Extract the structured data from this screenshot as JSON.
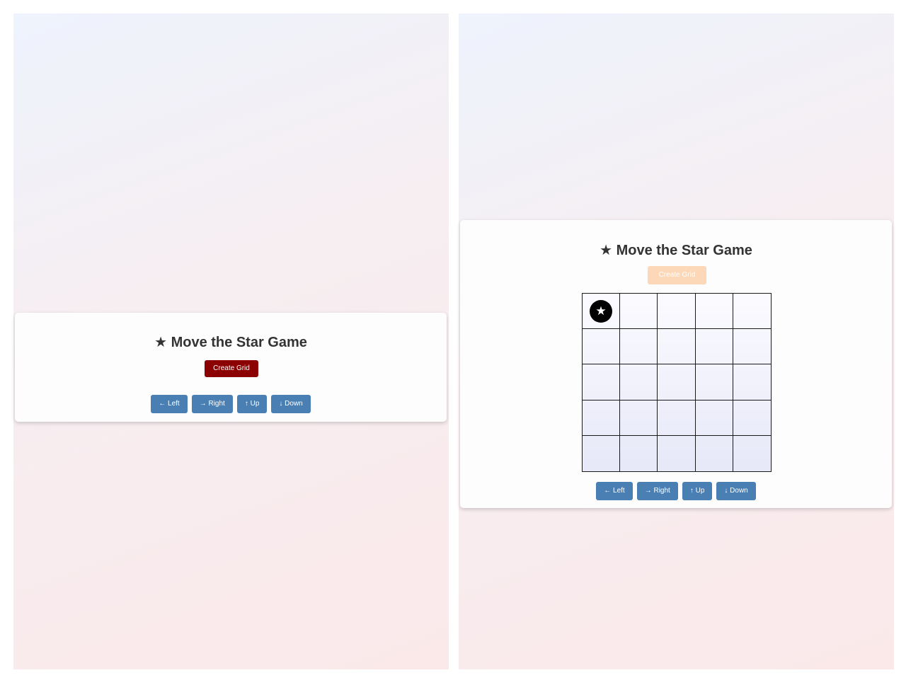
{
  "game": {
    "title": "★ Move the Star Game",
    "create_button_label": "Create Grid",
    "controls": {
      "left": "← Left",
      "right": "→ Right",
      "up": "↑ Up",
      "down": "↓ Down"
    }
  },
  "grid": {
    "rows": 5,
    "cols": 5,
    "star_position": {
      "row": 0,
      "col": 0
    },
    "star_symbol": "★"
  },
  "colors": {
    "create_button_active": "#8b0000",
    "create_button_disabled": "#fcd8b8",
    "control_button": "#4a7fb4",
    "star_token": "#000000"
  },
  "icons": {
    "star": "star-icon"
  }
}
